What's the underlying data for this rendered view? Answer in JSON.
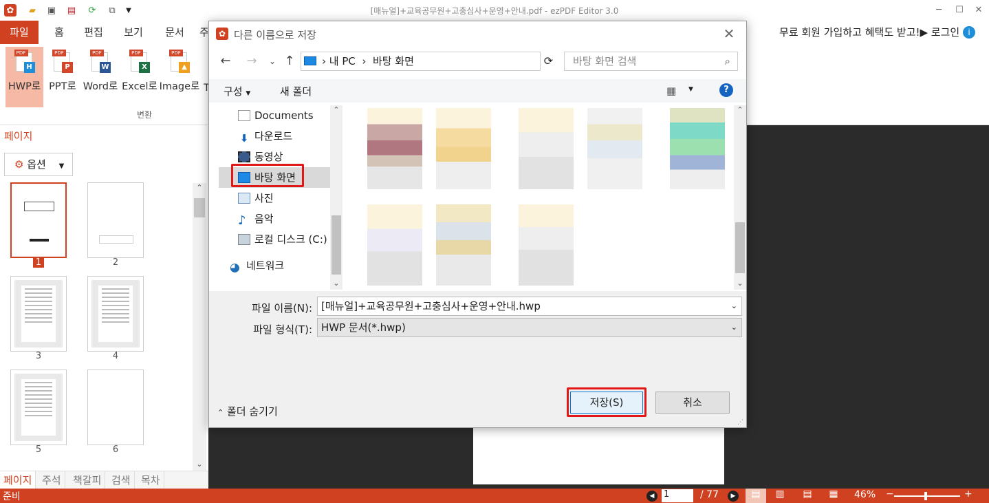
{
  "app": {
    "title": "[매뉴얼]+교육공무원+고충심사+운영+안내.pdf - ezPDF Editor 3.0"
  },
  "menu": {
    "file": "파일",
    "items": [
      "홈",
      "편집",
      "보기",
      "문서",
      "주"
    ],
    "promo": "무료 회원 가입하고 혜택도 받고!▶ 로그인"
  },
  "ribbon": {
    "buttons": [
      {
        "label": "HWP로",
        "badge": "H",
        "color": "#1f8ed8"
      },
      {
        "label": "PPT로",
        "badge": "P",
        "color": "#d2462a"
      },
      {
        "label": "Word로",
        "badge": "W",
        "color": "#2b5797"
      },
      {
        "label": "Excel로",
        "badge": "X",
        "color": "#1e7145"
      },
      {
        "label": "Image로",
        "badge": "▲",
        "color": "#f0a020"
      },
      {
        "label": "T"
      }
    ],
    "group_label": "변환"
  },
  "panel": {
    "title": "페이지",
    "options": "옵션",
    "pages": [
      "1",
      "2",
      "3",
      "4",
      "5",
      "6"
    ],
    "tabs": [
      "페이지",
      "주석",
      "책갈피",
      "검색",
      "목차"
    ]
  },
  "status": {
    "ready": "준비",
    "page_current": "1",
    "page_total": "/ 77",
    "zoom": "46%",
    "zoom_level": 0.46
  },
  "dialog": {
    "title": "다른 이름으로 저장",
    "path": [
      "내 PC",
      "바탕 화면"
    ],
    "search_placeholder": "바탕 화면 검색",
    "organize": "구성",
    "new_folder": "새 폴더",
    "tree": [
      "Documents",
      "다운로드",
      "동영상",
      "바탕 화면",
      "사진",
      "음악",
      "로컬 디스크 (C:)",
      "네트워크"
    ],
    "filename_label": "파일 이름(N):",
    "filename_value": "[매뉴얼]+교육공무원+고충심사+운영+안내.hwp",
    "filetype_label": "파일 형식(T):",
    "filetype_value": "HWP 문서(*.hwp)",
    "hide_folders": "폴더 숨기기",
    "save": "저장(S)",
    "cancel": "취소"
  },
  "colors": {
    "accent": "#cf4120",
    "highlight": "#e01818"
  }
}
